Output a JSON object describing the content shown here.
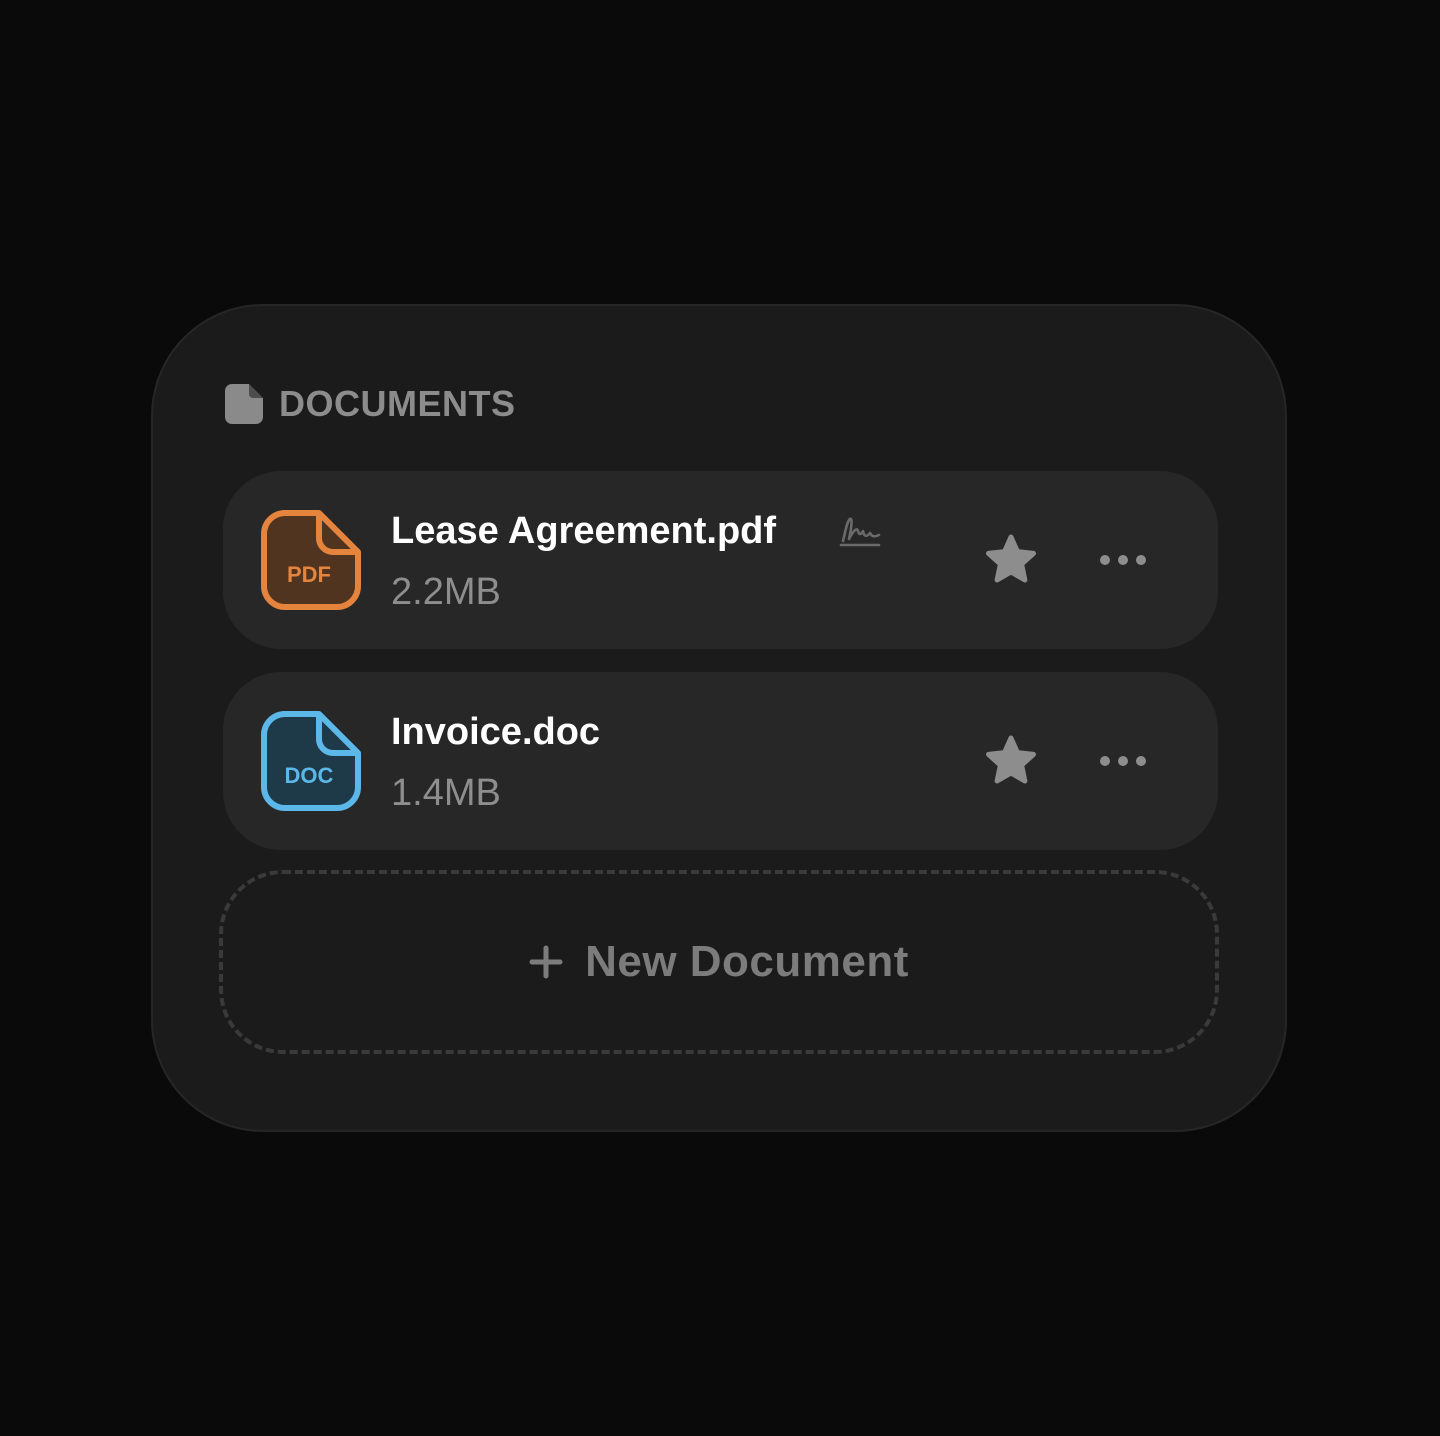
{
  "widget": {
    "title": "DOCUMENTS",
    "title_icon": "document-icon"
  },
  "files": [
    {
      "name": "Lease Agreement.pdf",
      "size": "2.2MB",
      "type_badge": "PDF",
      "icon": "pdf-file-icon",
      "accent_color": "#e5843c",
      "signed_icon": "signature-icon",
      "starred": true
    },
    {
      "name": "Invoice.doc",
      "size": "1.4MB",
      "type_badge": "DOC",
      "icon": "doc-file-icon",
      "accent_color": "#5bb8e8",
      "starred": true
    }
  ],
  "actions": {
    "star_icon": "star-icon",
    "more_icon": "more-options-icon"
  },
  "new_document": {
    "label": "New Document",
    "icon": "plus-icon"
  }
}
